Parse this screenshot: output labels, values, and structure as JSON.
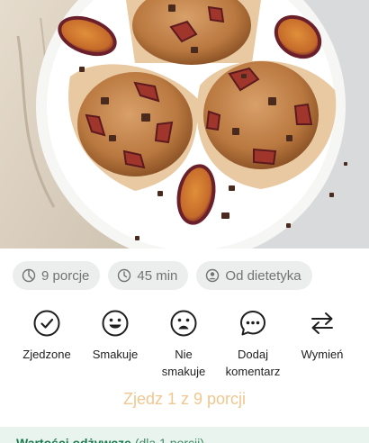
{
  "hero": {
    "alt": "plum chocolate muffins"
  },
  "chips": [
    {
      "icon": "pie-chart-icon",
      "label": "9 porcje"
    },
    {
      "icon": "clock-icon",
      "label": "45 min"
    },
    {
      "icon": "user-circle-icon",
      "label": "Od dietetyka"
    }
  ],
  "actions": [
    {
      "icon": "check-circle-icon",
      "label": "Zjedzone"
    },
    {
      "icon": "smile-icon",
      "label": "Smakuje"
    },
    {
      "icon": "sad-face-icon",
      "label": "Nie\nsmakuje"
    },
    {
      "icon": "chat-bubble-icon",
      "label": "Dodaj\nkomentarz"
    },
    {
      "icon": "swap-arrows-icon",
      "label": "Wymień"
    }
  ],
  "cta": {
    "label": "Zjedz 1 z 9 porcji"
  },
  "nutrition": {
    "title": "Wartości odżywcze",
    "subtitle": "(dla 1 porcji)"
  },
  "colors": {
    "chip_bg": "#eceeed",
    "chip_text": "#6f7472",
    "cta_text": "#f1c78f",
    "nutrition_bg": "#e9f4ef",
    "nutrition_text": "#1d7a4e"
  }
}
